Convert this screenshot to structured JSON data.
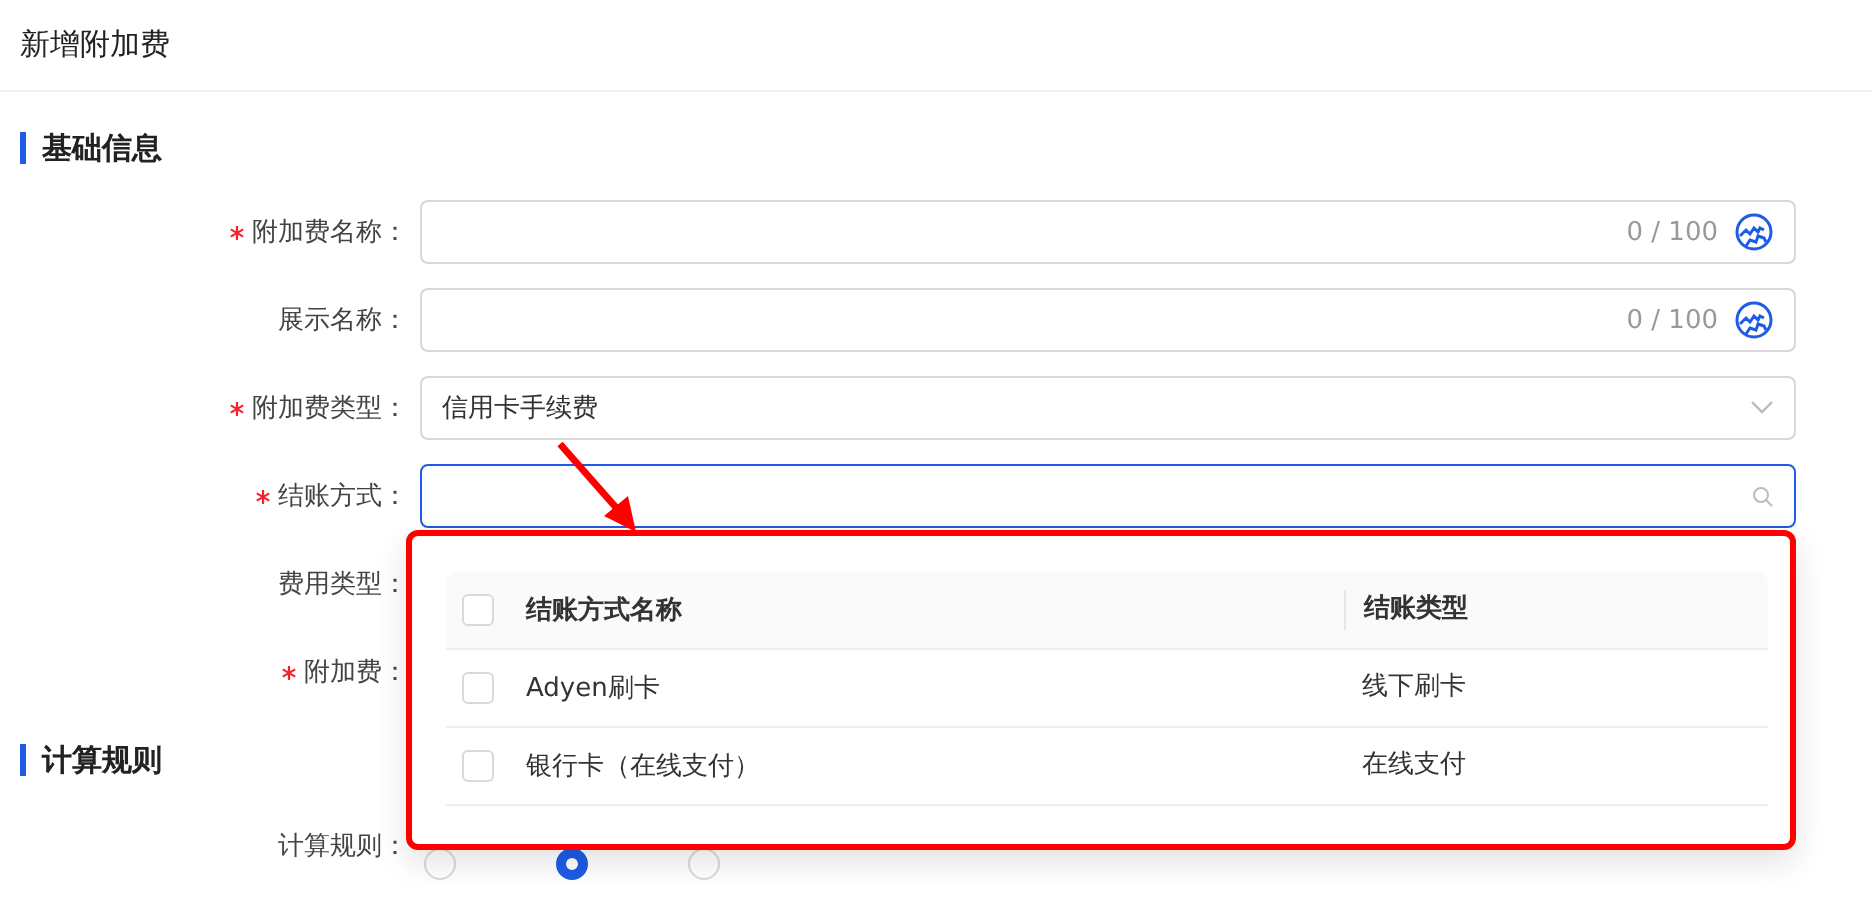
{
  "page_title": "新增附加费",
  "sections": [
    {
      "title": "基础信息",
      "fields": [
        {
          "label": "附加费名称：",
          "required": true,
          "kind": "text",
          "counter": "0 / 100"
        },
        {
          "label": "展示名称：",
          "required": false,
          "kind": "text",
          "counter": "0 / 100"
        },
        {
          "label": "附加费类型：",
          "required": true,
          "kind": "select",
          "value": "信用卡手续费"
        },
        {
          "label": "结账方式：",
          "required": true,
          "kind": "search",
          "focused": true
        },
        {
          "label": "费用类型：",
          "required": false,
          "kind": "covered"
        },
        {
          "label": "附加费：",
          "required": true,
          "kind": "covered"
        }
      ]
    },
    {
      "title": "计算规则",
      "fields": [
        {
          "label": "计算规则：",
          "required": false,
          "kind": "radios",
          "options": [
            {
              "selected": false
            },
            {
              "selected": true
            },
            {
              "selected": false
            }
          ]
        }
      ]
    }
  ],
  "dropdown": {
    "columns": [
      "结账方式名称",
      "结账类型"
    ],
    "all_checked": false,
    "rows": [
      {
        "name": "Adyen刷卡",
        "type": "线下刷卡",
        "checked": false
      },
      {
        "name": "银行卡（在线支付）",
        "type": "在线支付",
        "checked": false
      }
    ]
  }
}
